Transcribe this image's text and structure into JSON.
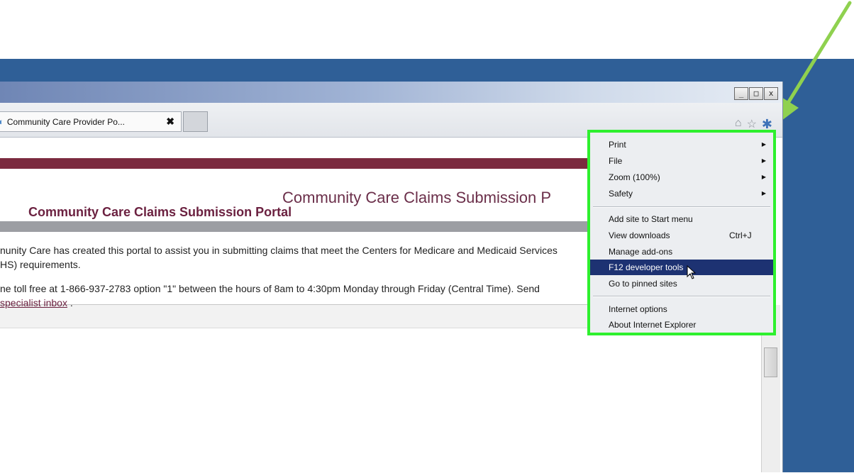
{
  "window": {
    "controls": [
      "_",
      "□",
      "x"
    ]
  },
  "tab": {
    "icon": "ie-page-icon",
    "title": "Community Care Provider Po...",
    "close": "✖"
  },
  "toolbar_icons": [
    "home-icon",
    "star-icon",
    "gear-icon"
  ],
  "page": {
    "site_title": "Community Care Claims Submission P",
    "heading": "Community Care Claims Submission Portal",
    "paragraph1_line1": "nunity Care has created this portal to assist you in submitting claims that meet the Centers for Medicare and Medicaid Services",
    "paragraph1_line2": "HS) requirements.",
    "paragraph2_line1": "ne toll free at 1-866-937-2783 option \"1\" between the hours of 8am to 4:30pm Monday through Friday (Central Time). Send",
    "paragraph2_link": "specialist inbox",
    "paragraph2_tail": " ."
  },
  "menu": {
    "group1": [
      {
        "label": "Print",
        "submenu": true
      },
      {
        "label": "File",
        "submenu": true
      },
      {
        "label": "Zoom (100%)",
        "submenu": true
      },
      {
        "label": "Safety",
        "submenu": true
      }
    ],
    "group2": [
      {
        "label": "Add site to Start menu"
      },
      {
        "label": "View downloads",
        "shortcut": "Ctrl+J"
      },
      {
        "label": "Manage add-ons"
      },
      {
        "label": "F12 developer tools",
        "highlighted": true
      },
      {
        "label": "Go to pinned sites"
      }
    ],
    "group3": [
      {
        "label": "Internet options"
      },
      {
        "label": "About Internet Explorer"
      }
    ]
  },
  "colors": {
    "annotation_green": "#2ef02e",
    "arrow_green": "#8fd14f",
    "maroon": "#7b2a3f",
    "menu_highlight": "#1d3272"
  }
}
